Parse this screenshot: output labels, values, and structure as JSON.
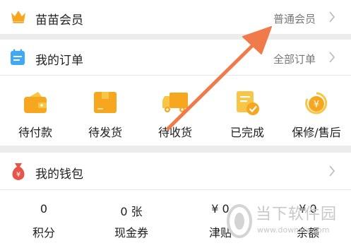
{
  "member": {
    "title": "苗苗会员",
    "right_text": "普通会员"
  },
  "orders": {
    "title": "我的订单",
    "right_text": "全部订单",
    "items": [
      {
        "label": "待付款",
        "icon": "wallet-icon"
      },
      {
        "label": "待发货",
        "icon": "package-box-icon"
      },
      {
        "label": "待收货",
        "icon": "delivery-truck-icon"
      },
      {
        "label": "已完成",
        "icon": "completed-document-icon"
      },
      {
        "label": "保修/售后",
        "icon": "yen-refund-icon"
      }
    ]
  },
  "wallet": {
    "title": "我的钱包",
    "items": [
      {
        "value": "0",
        "label": "积分"
      },
      {
        "value": "0 张",
        "label": "现金券"
      },
      {
        "value": "¥ 0",
        "label": "津贴"
      },
      {
        "value": "¥ 0",
        "label": "余额"
      }
    ]
  },
  "watermark": {
    "title": "当下软件园",
    "url": "www.downxia.com"
  },
  "colors": {
    "accent_orange": "#f7a620",
    "arrow": "#f07a4a",
    "calendar_blue": "#3fa9f5",
    "moneybag_red": "#e9544a",
    "separator": "#ececec"
  }
}
